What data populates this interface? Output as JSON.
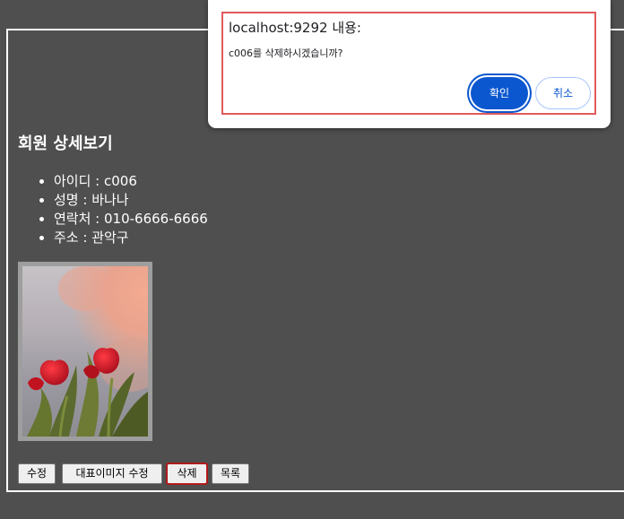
{
  "page": {
    "title": "회원 상세보기",
    "details": [
      "아이디 : c006",
      "성명 : 바나나",
      "연락처 : 010-6666-6666",
      "주소 : 관악구"
    ],
    "image": {
      "subject": "red tulips against pink sunset sky"
    },
    "buttons": {
      "edit": "수정",
      "edit_image": "대표이미지 수정",
      "delete": "삭제",
      "list": "목록"
    }
  },
  "dialog": {
    "title": "localhost:9292 내용:",
    "message": "c006를 삭제하시겠습니까?",
    "ok": "확인",
    "cancel": "취소"
  },
  "colors": {
    "background": "#4f4f4f",
    "dialog_primary": "#0b57d0",
    "focus_outline": "#b01a1a"
  }
}
